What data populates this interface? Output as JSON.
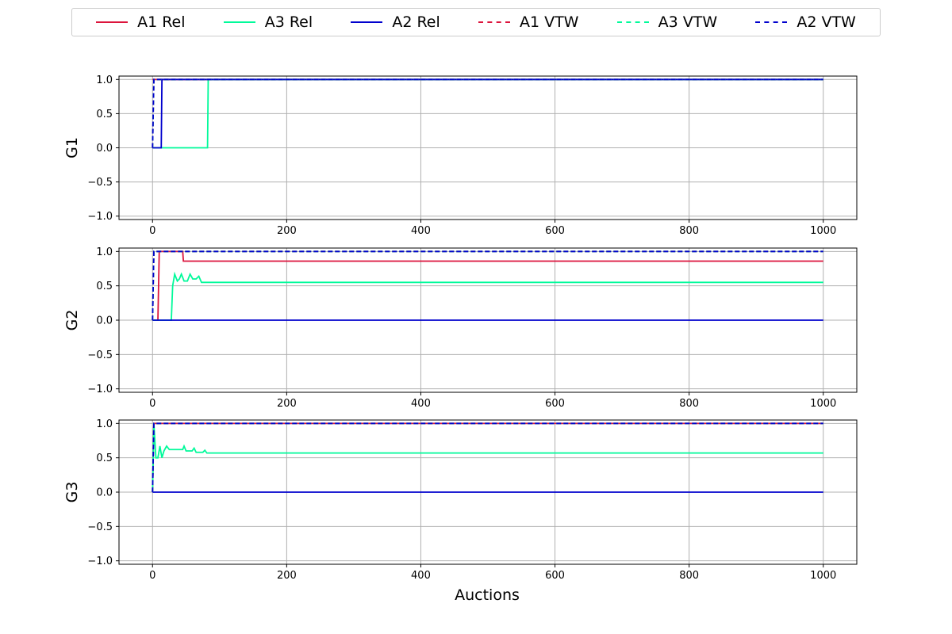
{
  "chart_data": {
    "type": "line",
    "xlabel": "Auctions",
    "xlim": [
      -50,
      1050
    ],
    "ylim": [
      -1.05,
      1.05
    ],
    "xticks": [
      0,
      200,
      400,
      600,
      800,
      1000
    ],
    "yticks": [
      1.0,
      0.5,
      0.0,
      -0.5,
      -1.0
    ],
    "xtick_labels": [
      "0",
      "200",
      "400",
      "600",
      "800",
      "1000"
    ],
    "ytick_labels": [
      "1.0",
      "0.5",
      "0.0",
      "−0.5",
      "−1.0"
    ],
    "grid": true,
    "legend_position": "top-center",
    "legend": [
      {
        "name": "A1 Rel",
        "color": "#dc143c",
        "style": "solid"
      },
      {
        "name": "A3 Rel",
        "color": "#00fa9a",
        "style": "solid"
      },
      {
        "name": "A2 Rel",
        "color": "#0000cd",
        "style": "solid"
      },
      {
        "name": "A1 VTW",
        "color": "#dc143c",
        "style": "dashed"
      },
      {
        "name": "A3 VTW",
        "color": "#00fa9a",
        "style": "dashed"
      },
      {
        "name": "A2 VTW",
        "color": "#0000cd",
        "style": "dashed"
      }
    ],
    "subplots": [
      {
        "ylabel": "G1",
        "series": [
          {
            "name": "A1 Rel",
            "color": "#dc143c",
            "dash": false,
            "points": [
              [
                0,
                1
              ],
              [
                1000,
                1
              ]
            ]
          },
          {
            "name": "A3 Rel",
            "color": "#00fa9a",
            "dash": false,
            "points": [
              [
                0,
                0
              ],
              [
                82,
                0
              ],
              [
                83,
                1
              ],
              [
                1000,
                1
              ]
            ]
          },
          {
            "name": "A2 Rel",
            "color": "#0000cd",
            "dash": false,
            "points": [
              [
                0,
                0
              ],
              [
                13,
                0
              ],
              [
                14,
                1
              ],
              [
                1000,
                1
              ]
            ]
          },
          {
            "name": "A1 VTW",
            "color": "#dc143c",
            "dash": true,
            "points": [
              [
                0,
                0
              ],
              [
                2,
                1
              ],
              [
                1000,
                1
              ]
            ]
          },
          {
            "name": "A3 VTW",
            "color": "#00fa9a",
            "dash": true,
            "points": [
              [
                0,
                0
              ],
              [
                2,
                1
              ],
              [
                1000,
                1
              ]
            ]
          },
          {
            "name": "A2 VTW",
            "color": "#0000cd",
            "dash": true,
            "points": [
              [
                0,
                0
              ],
              [
                2,
                1
              ],
              [
                1000,
                1
              ]
            ]
          }
        ]
      },
      {
        "ylabel": "G2",
        "series": [
          {
            "name": "A1 Rel",
            "color": "#dc143c",
            "dash": false,
            "points": [
              [
                0,
                0
              ],
              [
                8,
                0
              ],
              [
                10,
                1
              ],
              [
                45,
                1
              ],
              [
                46,
                0.86
              ],
              [
                1000,
                0.86
              ]
            ]
          },
          {
            "name": "A3 Rel",
            "color": "#00fa9a",
            "dash": false,
            "points": [
              [
                0,
                0
              ],
              [
                28,
                0
              ],
              [
                30,
                0.5
              ],
              [
                33,
                0.67
              ],
              [
                37,
                0.57
              ],
              [
                40,
                0.6
              ],
              [
                43,
                0.67
              ],
              [
                47,
                0.57
              ],
              [
                52,
                0.57
              ],
              [
                56,
                0.67
              ],
              [
                60,
                0.6
              ],
              [
                65,
                0.6
              ],
              [
                69,
                0.64
              ],
              [
                73,
                0.55
              ],
              [
                1000,
                0.55
              ]
            ]
          },
          {
            "name": "A2 Rel",
            "color": "#0000cd",
            "dash": false,
            "points": [
              [
                0,
                0
              ],
              [
                1000,
                0
              ]
            ]
          },
          {
            "name": "A1 VTW",
            "color": "#dc143c",
            "dash": true,
            "points": [
              [
                0,
                0
              ],
              [
                2,
                1
              ],
              [
                1000,
                1
              ]
            ]
          },
          {
            "name": "A3 VTW",
            "color": "#00fa9a",
            "dash": true,
            "points": [
              [
                0,
                0
              ],
              [
                2,
                1
              ],
              [
                1000,
                1
              ]
            ]
          },
          {
            "name": "A2 VTW",
            "color": "#0000cd",
            "dash": true,
            "points": [
              [
                0,
                0
              ],
              [
                2,
                1
              ],
              [
                1000,
                1
              ]
            ]
          }
        ]
      },
      {
        "ylabel": "G3",
        "series": [
          {
            "name": "A1 Rel",
            "color": "#dc143c",
            "dash": false,
            "points": [
              [
                0,
                0
              ],
              [
                2,
                1
              ],
              [
                1000,
                1
              ]
            ]
          },
          {
            "name": "A3 Rel",
            "color": "#00fa9a",
            "dash": false,
            "points": [
              [
                0,
                0
              ],
              [
                2,
                1
              ],
              [
                5,
                0.5
              ],
              [
                8,
                0.5
              ],
              [
                11,
                0.67
              ],
              [
                14,
                0.5
              ],
              [
                17,
                0.6
              ],
              [
                21,
                0.67
              ],
              [
                25,
                0.62
              ],
              [
                30,
                0.62
              ],
              [
                45,
                0.62
              ],
              [
                47,
                0.67
              ],
              [
                50,
                0.6
              ],
              [
                59,
                0.6
              ],
              [
                62,
                0.64
              ],
              [
                65,
                0.58
              ],
              [
                75,
                0.58
              ],
              [
                78,
                0.61
              ],
              [
                81,
                0.57
              ],
              [
                1000,
                0.57
              ]
            ]
          },
          {
            "name": "A2 Rel",
            "color": "#0000cd",
            "dash": false,
            "points": [
              [
                0,
                0
              ],
              [
                1000,
                0
              ]
            ]
          },
          {
            "name": "A1 VTW",
            "color": "#dc143c",
            "dash": true,
            "points": [
              [
                0,
                0
              ],
              [
                2,
                1
              ],
              [
                1000,
                1
              ]
            ]
          },
          {
            "name": "A3 VTW",
            "color": "#00fa9a",
            "dash": true,
            "points": [
              [
                0,
                0
              ],
              [
                2,
                1
              ],
              [
                1000,
                1
              ]
            ]
          },
          {
            "name": "A2 VTW",
            "color": "#0000cd",
            "dash": true,
            "points": [
              [
                0,
                0
              ],
              [
                2,
                1
              ],
              [
                1000,
                1
              ]
            ]
          }
        ]
      }
    ]
  }
}
